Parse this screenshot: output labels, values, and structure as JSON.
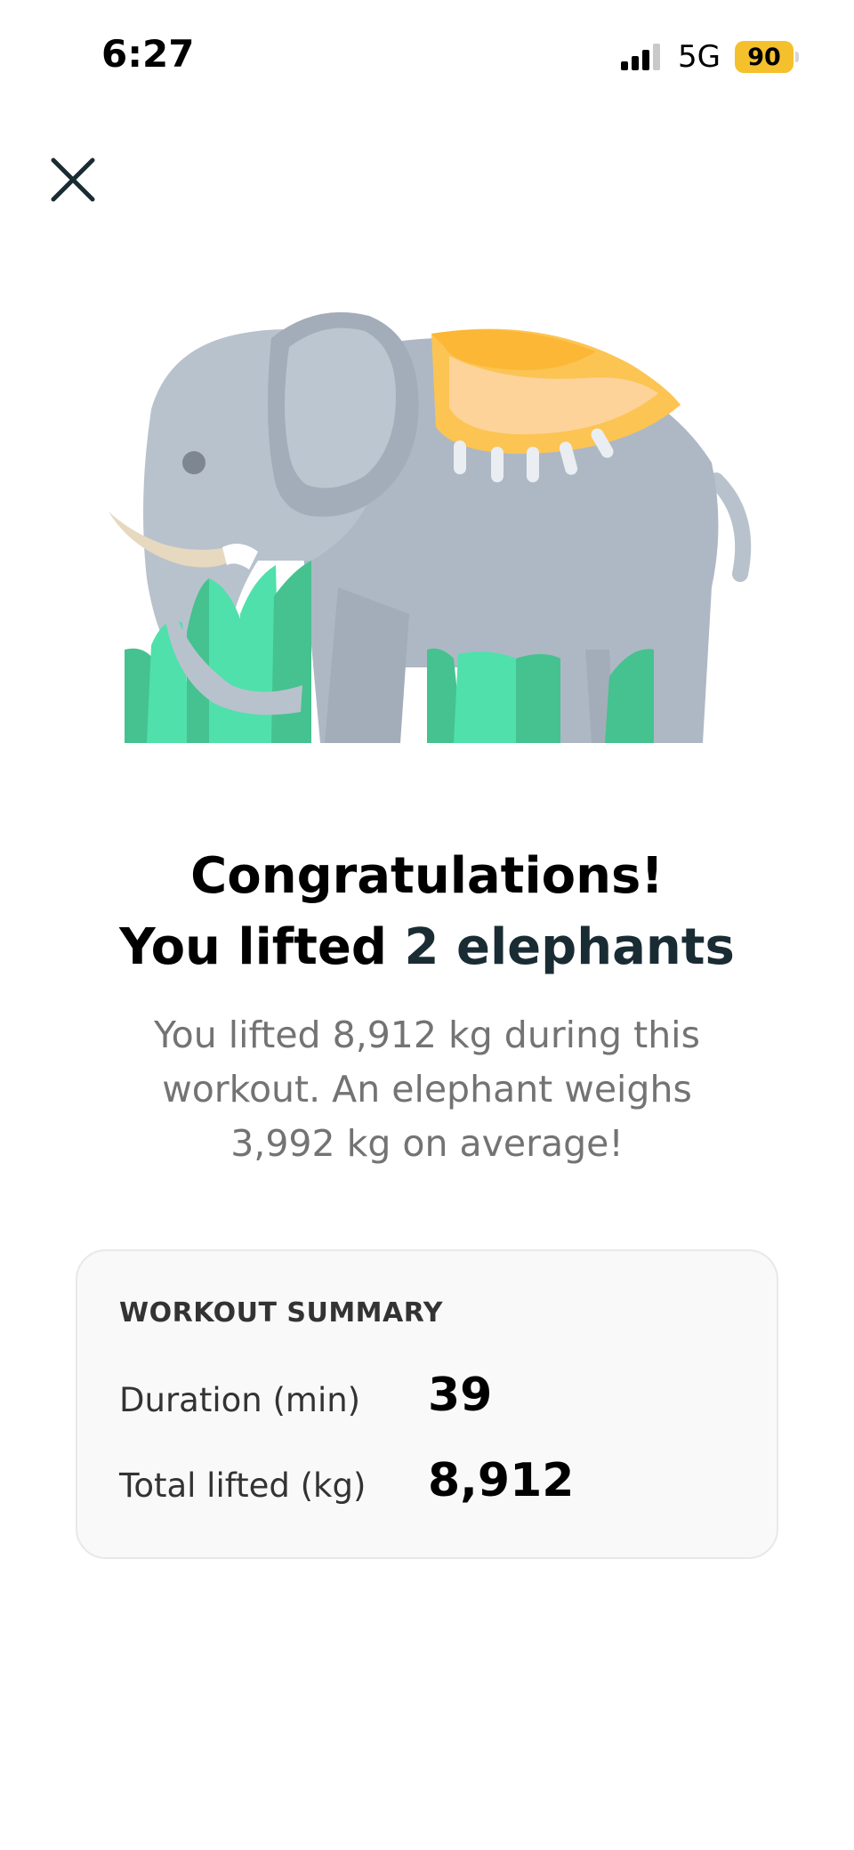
{
  "status_bar": {
    "time": "6:27",
    "network": "5G",
    "battery": "90",
    "signal_icon": "cellular-signal-icon",
    "battery_color": "#f4c12d"
  },
  "close_icon": "close-icon",
  "illustration_icon": "elephant-illustration",
  "headline": {
    "line1": "Congratulations!",
    "line2_prefix": "You lifted ",
    "line2_accent": "2 elephants",
    "accent_color": "#1a2c33"
  },
  "description": "You lifted 8,912 kg during this workout. An elephant weighs 3,992 kg on average!",
  "summary": {
    "title": "WORKOUT SUMMARY",
    "rows": [
      {
        "label": "Duration (min)",
        "value": "39"
      },
      {
        "label": "Total lifted (kg)",
        "value": "8,912"
      }
    ]
  }
}
